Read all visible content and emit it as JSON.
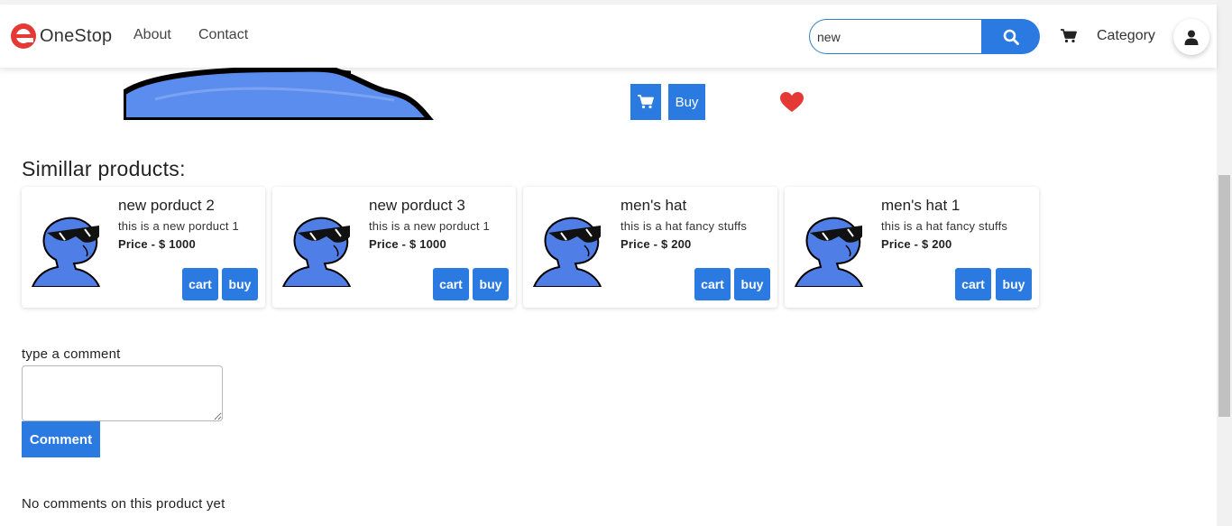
{
  "navbar": {
    "brand": "OneStop",
    "links": [
      "About",
      "Contact"
    ],
    "search": {
      "value": "new",
      "placeholder": ""
    },
    "category": "Category"
  },
  "product": {
    "buy_label": "Buy"
  },
  "similar": {
    "title": "Simillar products:",
    "cards": [
      {
        "name": "new porduct 2",
        "description": "this is a new porduct 1",
        "price": "Price - $ 1000",
        "cart_label": "cart",
        "buy_label": "buy"
      },
      {
        "name": "new porduct 3",
        "description": "this is a new porduct 1",
        "price": "Price - $ 1000",
        "cart_label": "cart",
        "buy_label": "buy"
      },
      {
        "name": "men's hat",
        "description": "this is a hat fancy stuffs",
        "price": "Price - $ 200",
        "cart_label": "cart",
        "buy_label": "buy"
      },
      {
        "name": "men's hat 1",
        "description": "this is a hat fancy stuffs",
        "price": "Price - $ 200",
        "cart_label": "cart",
        "buy_label": "buy"
      }
    ]
  },
  "comments": {
    "label": "type a comment",
    "button": "Comment",
    "empty": "No comments on this product yet"
  },
  "colors": {
    "accent": "#2a7ae2",
    "brand_logo": "#e53935",
    "heart": "#e53935"
  },
  "icons": {
    "search": "search-icon",
    "cart": "cart-icon",
    "user": "user-icon",
    "heart": "heart-icon",
    "logo": "logo-icon"
  }
}
